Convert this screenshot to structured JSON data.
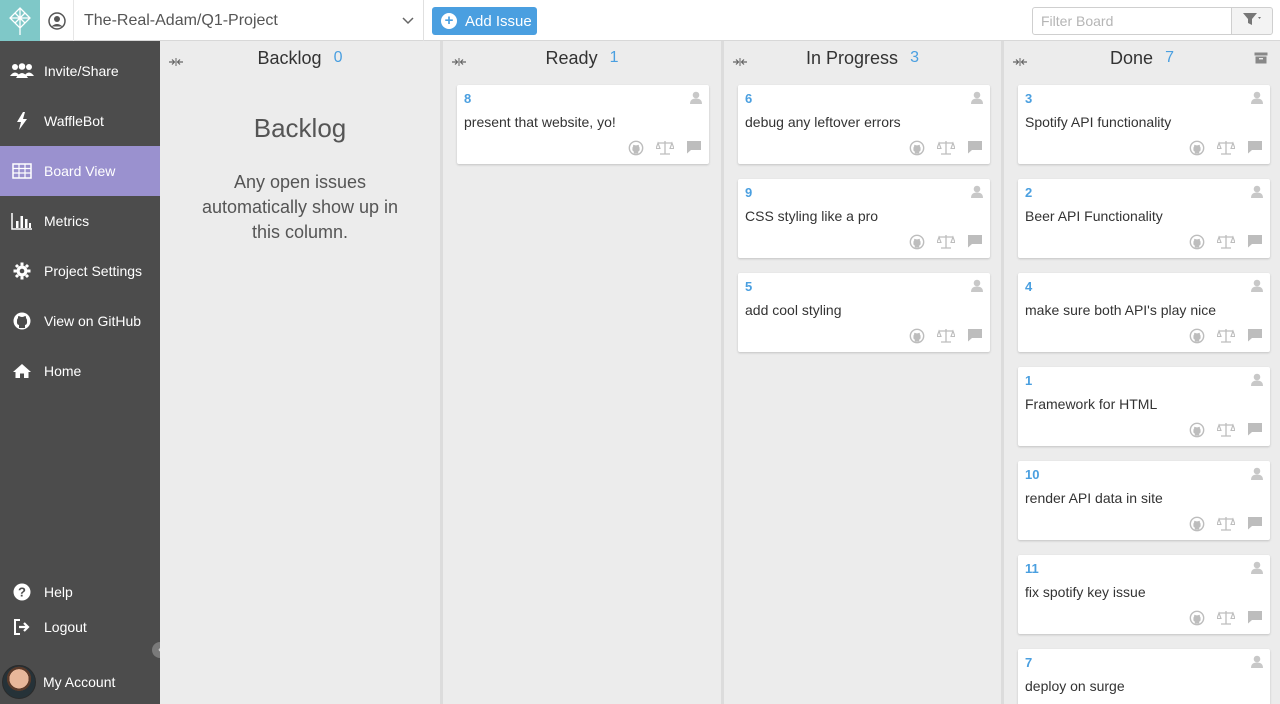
{
  "topbar": {
    "repo": "The-Real-Adam/Q1-Project",
    "add_issue_label": "Add Issue",
    "filter_placeholder": "Filter Board"
  },
  "sidebar": {
    "items": [
      {
        "label": "Invite/Share",
        "icon": "users-icon"
      },
      {
        "label": "WaffleBot",
        "icon": "bolt-icon"
      },
      {
        "label": "Board View",
        "icon": "table-icon",
        "active": true
      },
      {
        "label": "Metrics",
        "icon": "bar-chart-icon"
      },
      {
        "label": "Project Settings",
        "icon": "gear-icon"
      },
      {
        "label": "View on GitHub",
        "icon": "github-icon"
      },
      {
        "label": "Home",
        "icon": "home-icon"
      }
    ],
    "bottom": [
      {
        "label": "Help",
        "icon": "help-icon"
      },
      {
        "label": "Logout",
        "icon": "logout-icon"
      }
    ],
    "account_label": "My Account"
  },
  "columns": [
    {
      "title": "Backlog",
      "count": "0",
      "empty_title": "Backlog",
      "empty_text": "Any open issues automatically show up in this column.",
      "cards": []
    },
    {
      "title": "Ready",
      "count": "1",
      "cards": [
        {
          "num": "8",
          "title": "present that website, yo!"
        }
      ]
    },
    {
      "title": "In Progress",
      "count": "3",
      "cards": [
        {
          "num": "6",
          "title": "debug any leftover errors"
        },
        {
          "num": "9",
          "title": "CSS styling like a pro"
        },
        {
          "num": "5",
          "title": "add cool styling"
        }
      ]
    },
    {
      "title": "Done",
      "count": "7",
      "cards": [
        {
          "num": "3",
          "title": "Spotify API functionality"
        },
        {
          "num": "2",
          "title": "Beer API Functionality"
        },
        {
          "num": "4",
          "title": "make sure both API's play nice"
        },
        {
          "num": "1",
          "title": "Framework for HTML"
        },
        {
          "num": "10",
          "title": "render API data in site"
        },
        {
          "num": "11",
          "title": "fix spotify key issue"
        },
        {
          "num": "7",
          "title": "deploy on surge"
        }
      ]
    }
  ],
  "colors": {
    "accent": "#4a9fe0",
    "sidebar_bg": "#4c4c4c",
    "active_nav": "#9a91cf",
    "logo_bg": "#7fc8c8"
  }
}
